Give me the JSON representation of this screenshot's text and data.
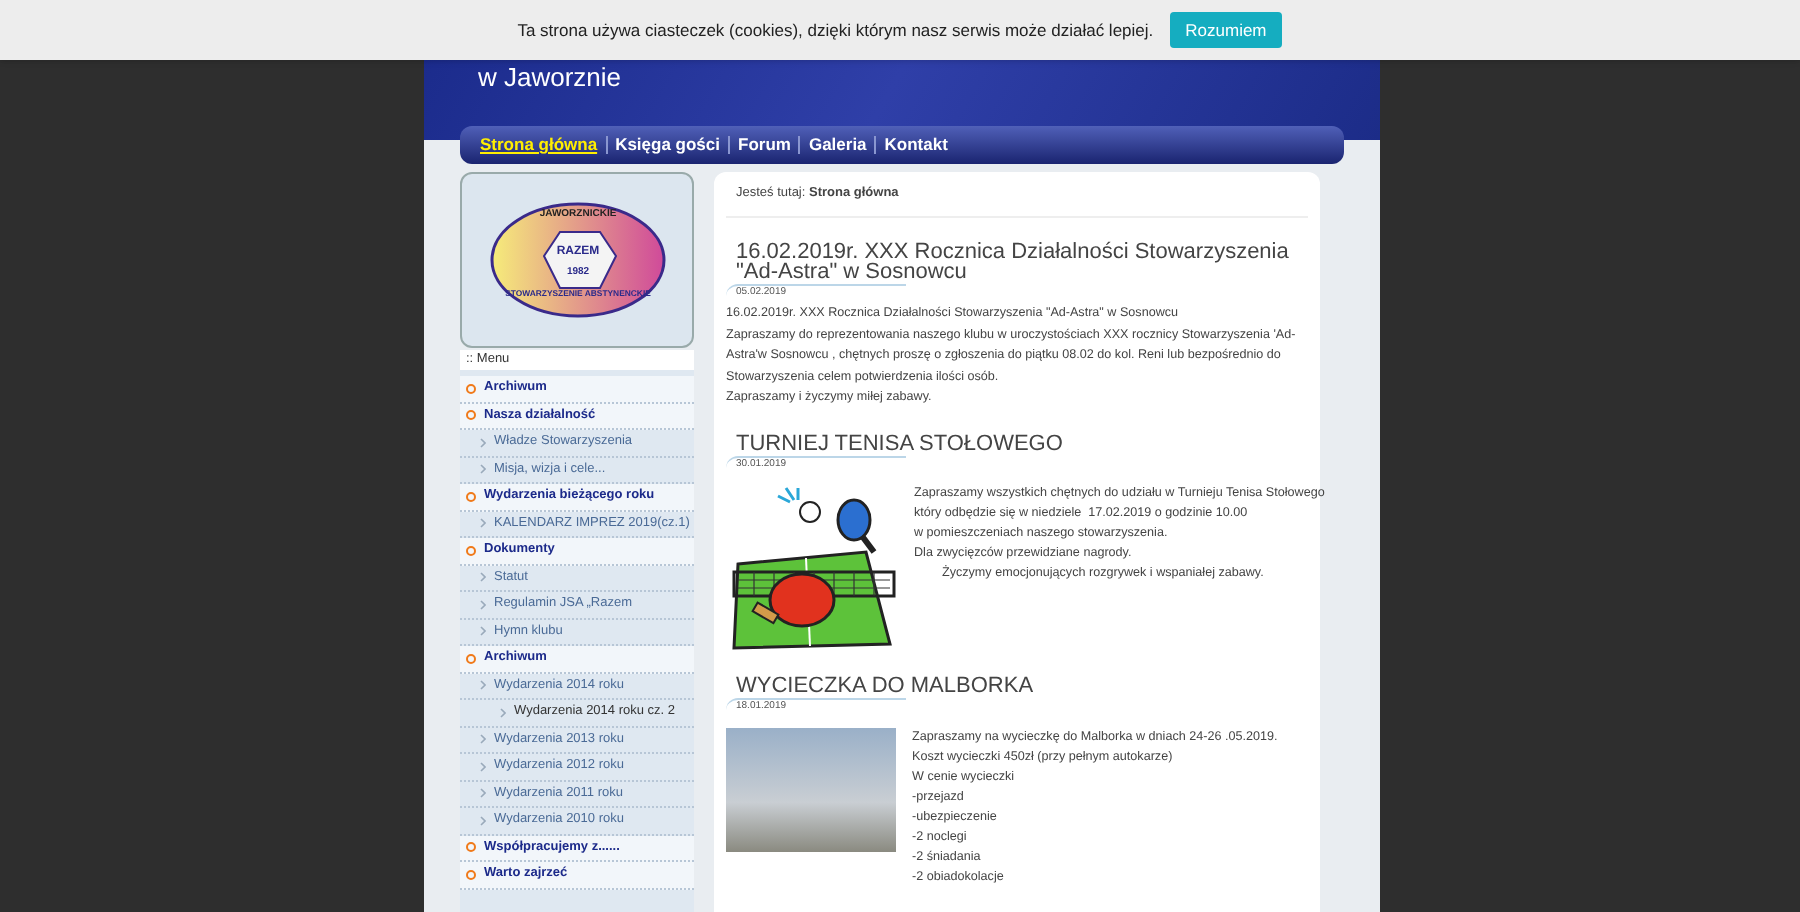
{
  "cookie_bar": {
    "message": "Ta strona używa ciasteczek (cookies), dzięki którym nasz serwis może działać lepiej.",
    "button": "Rozumiem"
  },
  "header": {
    "subtitle": "w Jaworznie"
  },
  "nav": [
    {
      "label": "Strona główna",
      "selected": true
    },
    {
      "label": "Księga gości",
      "selected": false
    },
    {
      "label": "Forum",
      "selected": false
    },
    {
      "label": "Galeria",
      "selected": false
    },
    {
      "label": "Kontakt",
      "selected": false
    }
  ],
  "logo": {
    "top": "JAWORZNICKIE",
    "middle": "RAZEM",
    "year": "1982",
    "bottom": "STOWARZYSZENIE ABSTYNENCKIE"
  },
  "menu": {
    "title": ":: Menu",
    "items": [
      {
        "label": "Archiwum"
      },
      {
        "label": "Nasza działalność",
        "children": [
          {
            "label": "Władze Stowarzyszenia"
          },
          {
            "label": "Misja, wizja i cele..."
          }
        ]
      },
      {
        "label": "Wydarzenia bieżącego roku",
        "children": [
          {
            "label": "KALENDARZ IMPREZ 2019(cz.1)"
          }
        ]
      },
      {
        "label": "Dokumenty",
        "children": [
          {
            "label": "Statut"
          },
          {
            "label": "Regulamin JSA „Razem"
          },
          {
            "label": "Hymn klubu"
          }
        ]
      },
      {
        "label": "Archiwum",
        "children": [
          {
            "label": "Wydarzenia 2014 roku",
            "children": [
              {
                "label": "Wydarzenia 2014 roku cz. 2"
              }
            ]
          },
          {
            "label": "Wydarzenia 2013 roku"
          },
          {
            "label": "Wydarzenia 2012 roku"
          },
          {
            "label": "Wydarzenia 2011 roku"
          },
          {
            "label": "Wydarzenia 2010 roku"
          }
        ]
      },
      {
        "label": "Współpracujemy z......"
      },
      {
        "label": "Warto zajrzeć"
      }
    ]
  },
  "breadcrumb": {
    "prefix": "Jesteś tutaj:",
    "current": "Strona główna"
  },
  "articles": [
    {
      "kind": "text",
      "title": "16.02.2019r. XXX Rocznica Działalności Stowarzyszenia \"Ad-Astra\" w Sosnowcu",
      "date": "05.02.2019",
      "lines": [
        "16.02.2019r. XXX Rocznica Działalności Stowarzyszenia \"Ad-Astra\" w Sosnowcu",
        "Zapraszamy do reprezentowania naszego klubu w uroczystościach XXX rocznicy Stowarzyszenia 'Ad-Astra'w Sosnowcu , chętnych proszę o zgłoszenia do piątku 08.02 do kol. Reni  lub bezpośrednio do Stowarzyszenia celem potwierdzenia ilości osób.",
        "Zapraszamy i życzymy miłej zabawy."
      ]
    },
    {
      "kind": "pingpong",
      "title": "TURNIEJ TENISA STOŁOWEGO",
      "date": "30.01.2019",
      "lines": [
        "Zapraszamy wszystkich chętnych do udziału w Turnieju Tenisa Stołowego",
        "który odbędzie się w niedziele  17.02.2019 o godzinie 10.00",
        "w pomieszczeniach naszego stowarzyszenia.",
        "Dla zwycięzców przewidziane nagrody.",
        "        Życzymy emocjonujących rozgrywek i wspaniałej zabawy."
      ]
    },
    {
      "kind": "photo",
      "title": "WYCIECZKA DO MALBORKA",
      "date": "18.01.2019",
      "lines": [
        "Zapraszamy na wycieczkę do Malborka w dniach 24-26 .05.2019.",
        "Koszt wycieczki 450zł (przy pełnym autokarze)",
        "W cenie wycieczki",
        "-przejazd",
        "-ubezpieczenie",
        "-2 noclegi",
        "-2 śniadania",
        "-2 obiadokolacje"
      ]
    }
  ]
}
